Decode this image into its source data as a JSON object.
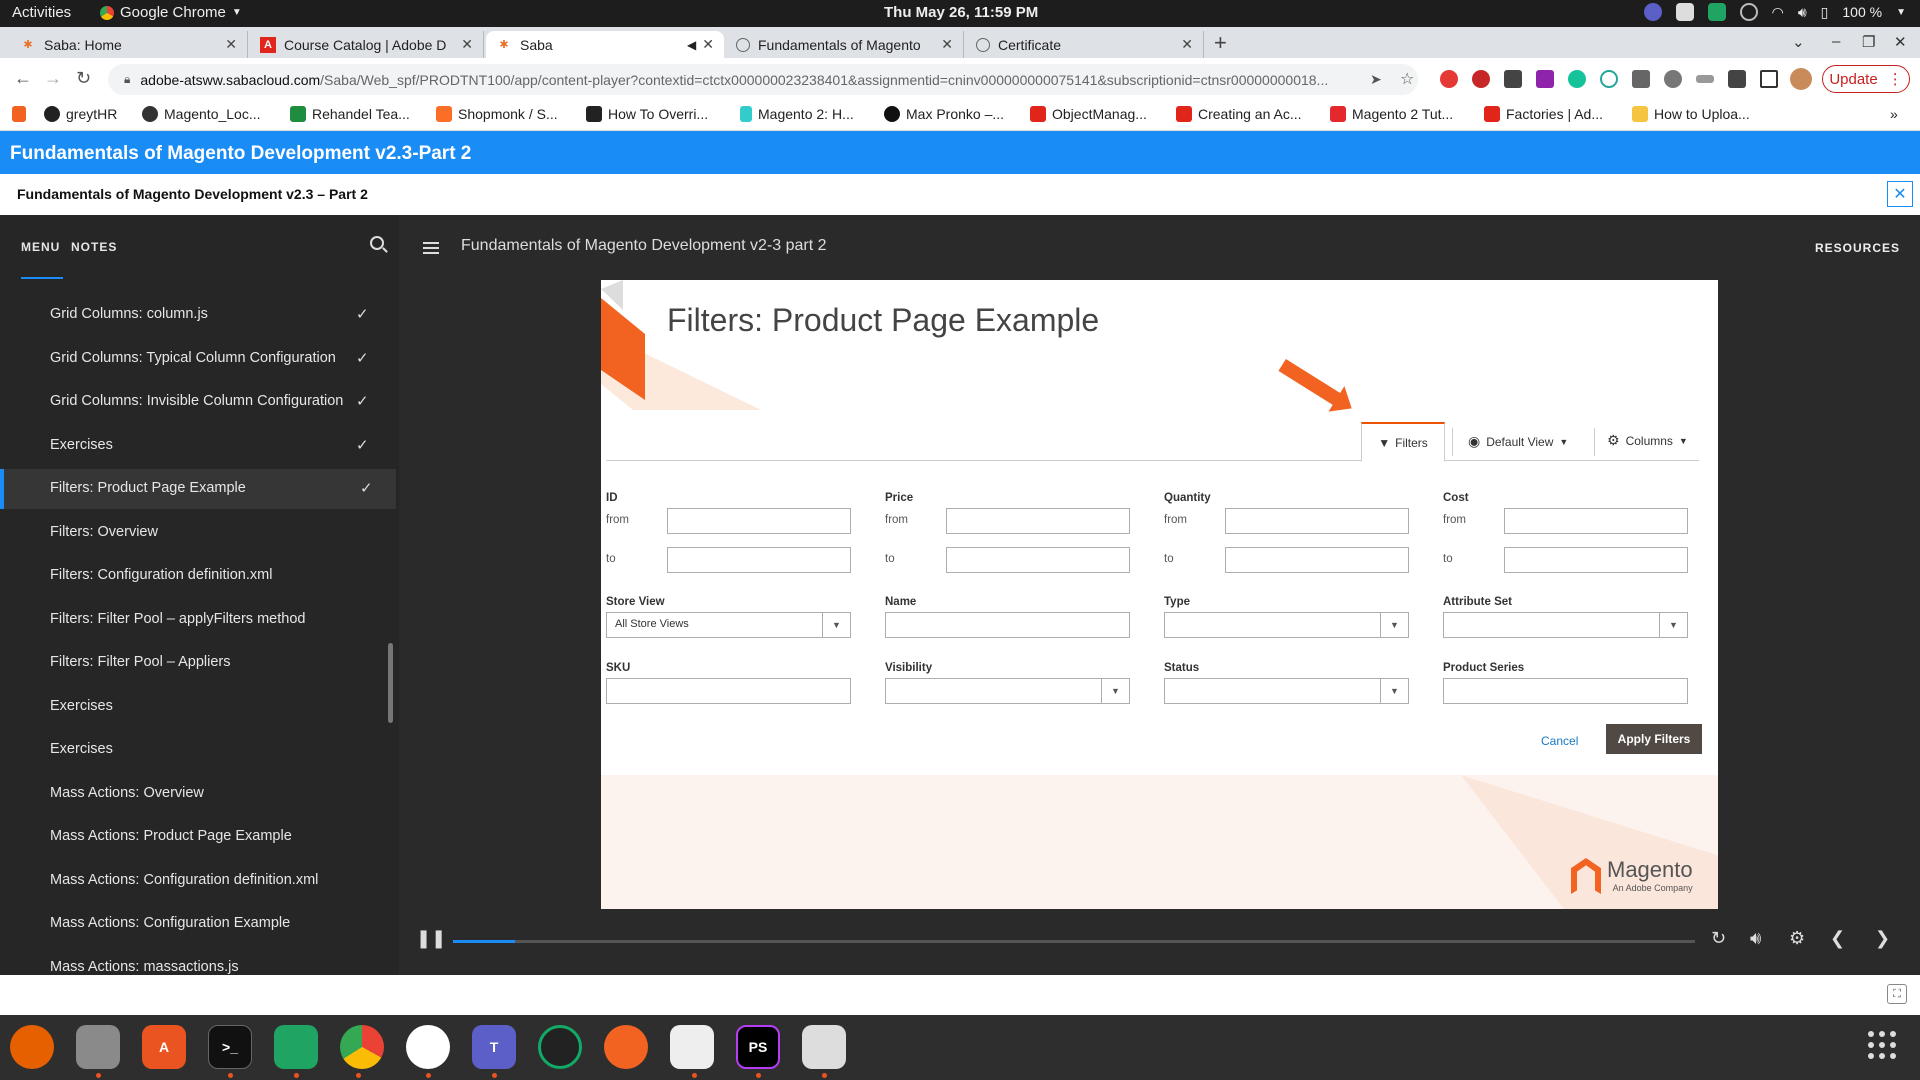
{
  "system_bar": {
    "activities": "Activities",
    "app_name": "Google Chrome",
    "clock": "Thu May 26, 11:59 PM",
    "battery": "100 %"
  },
  "browser": {
    "tabs": [
      {
        "title": "Saba: Home",
        "active": false
      },
      {
        "title": "Course Catalog | Adobe D",
        "active": false
      },
      {
        "title": "Saba",
        "active": true
      },
      {
        "title": "Fundamentals of Magento",
        "active": false
      },
      {
        "title": "Certificate",
        "active": false
      }
    ],
    "url_host": "adobe-atsww.sabacloud.com",
    "url_path": "/Saba/Web_spf/PRODTNT100/app/content-player?contextid=ctctx000000023238401&assignmentid=cninv000000000075141&subscriptionid=ctnsr00000000018...",
    "update_label": "Update",
    "bookmarks": [
      "greytHR",
      "Magento_Loc...",
      "Rehandel Tea...",
      "Shopmonk / S...",
      "How To Overri...",
      "Magento 2: H...",
      "Max Pronko –...",
      "ObjectManag...",
      "Creating an Ac...",
      "Magento 2 Tut...",
      "Factories | Ad...",
      "How to Uploa..."
    ],
    "bookmark_more": "»"
  },
  "player": {
    "header_title": "Fundamentals of Magento Development v2.3-Part 2",
    "sub_title": "Fundamentals of Magento Development v2.3 – Part 2",
    "menu_label": "MENU",
    "notes_label": "NOTES",
    "resources_label": "RESOURCES",
    "lesson_title": "Fundamentals of Magento Development v2-3 part 2",
    "menu_items": [
      {
        "label": "Grid Columns: column.js",
        "done": true,
        "active": false
      },
      {
        "label": "Grid Columns: Typical Column Configuration",
        "done": true,
        "active": false
      },
      {
        "label": "Grid Columns: Invisible Column Configuration",
        "done": true,
        "active": false
      },
      {
        "label": "Exercises",
        "done": true,
        "active": false
      },
      {
        "label": "Filters: Product Page Example",
        "done": true,
        "active": true
      },
      {
        "label": "Filters: Overview",
        "done": false,
        "active": false
      },
      {
        "label": "Filters: Configuration definition.xml",
        "done": false,
        "active": false
      },
      {
        "label": "Filters: Filter Pool – applyFilters method",
        "done": false,
        "active": false
      },
      {
        "label": "Filters: Filter Pool – Appliers",
        "done": false,
        "active": false
      },
      {
        "label": "Exercises",
        "done": false,
        "active": false
      },
      {
        "label": "Exercises",
        "done": false,
        "active": false
      },
      {
        "label": "Mass Actions: Overview",
        "done": false,
        "active": false
      },
      {
        "label": "Mass Actions: Product Page Example",
        "done": false,
        "active": false
      },
      {
        "label": "Mass Actions: Configuration definition.xml",
        "done": false,
        "active": false
      },
      {
        "label": "Mass Actions: Configuration Example",
        "done": false,
        "active": false
      },
      {
        "label": "Mass Actions: massactions.js",
        "done": false,
        "active": false
      }
    ],
    "progress_fraction": 0.05
  },
  "slide": {
    "title": "Filters: Product Page Example",
    "filters_tab": "Filters",
    "default_view": "Default View",
    "columns": "Columns",
    "from_label": "from",
    "to_label": "to",
    "range_fields": [
      "ID",
      "Price",
      "Quantity",
      "Cost"
    ],
    "row2": {
      "store_view": "Store View",
      "store_view_value": "All Store Views",
      "name": "Name",
      "type": "Type",
      "attribute_set": "Attribute Set"
    },
    "row3": {
      "sku": "SKU",
      "visibility": "Visibility",
      "status": "Status",
      "product_series": "Product Series"
    },
    "cancel": "Cancel",
    "apply": "Apply Filters",
    "brand": "Magento",
    "brand_tag": "An Adobe Company"
  },
  "icons": {
    "colors": {
      "accent_blue": "#1a8cf5",
      "magento_orange": "#f26322",
      "apply_button": "#514943"
    }
  }
}
